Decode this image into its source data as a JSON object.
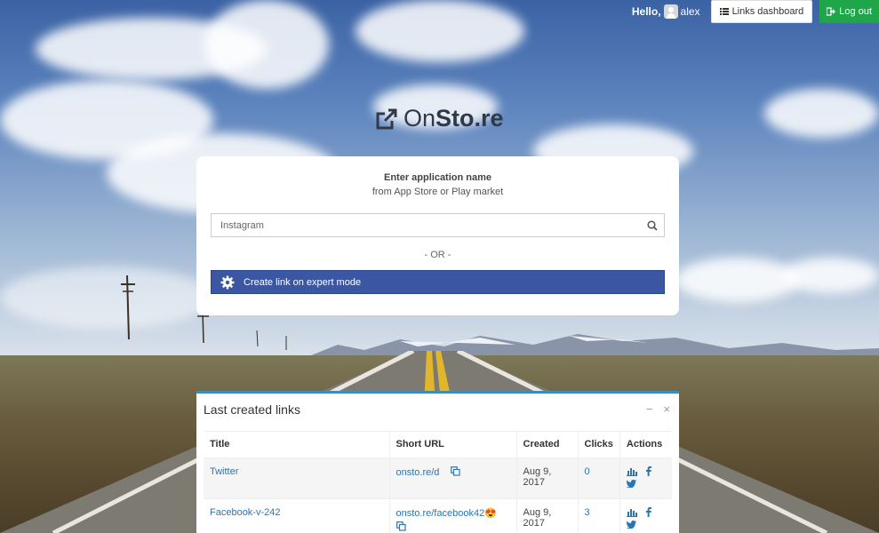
{
  "topbar": {
    "greeting": "Hello,",
    "username": "alex",
    "dashboard_label": "Links dashboard",
    "logout_label": "Log out"
  },
  "logo": {
    "light": "On",
    "bold": "Sto.re"
  },
  "search_card": {
    "heading": "Enter application name",
    "subheading": "from App Store or Play market",
    "search_placeholder": "Instagram",
    "or_text": "- OR -",
    "expert_button_label": "Create link on expert mode"
  },
  "links_panel": {
    "title": "Last created links",
    "minimize": "−",
    "close": "×",
    "columns": [
      "Title",
      "Short URL",
      "Created",
      "Clicks",
      "Actions"
    ],
    "rows": [
      {
        "title": "Twitter",
        "short_url": "onsto.re/d",
        "created": "Aug 9, 2017",
        "clicks": "0"
      },
      {
        "title": "Facebook-v-242",
        "short_url": "onsto.re/facebook42😍",
        "created": "Aug 9, 2017",
        "clicks": "3"
      }
    ]
  },
  "colors": {
    "accent_blue": "#3b57a4",
    "link_blue": "#2a75b5",
    "logout_green": "#1fa64a",
    "panel_border": "#3c8dbc"
  }
}
